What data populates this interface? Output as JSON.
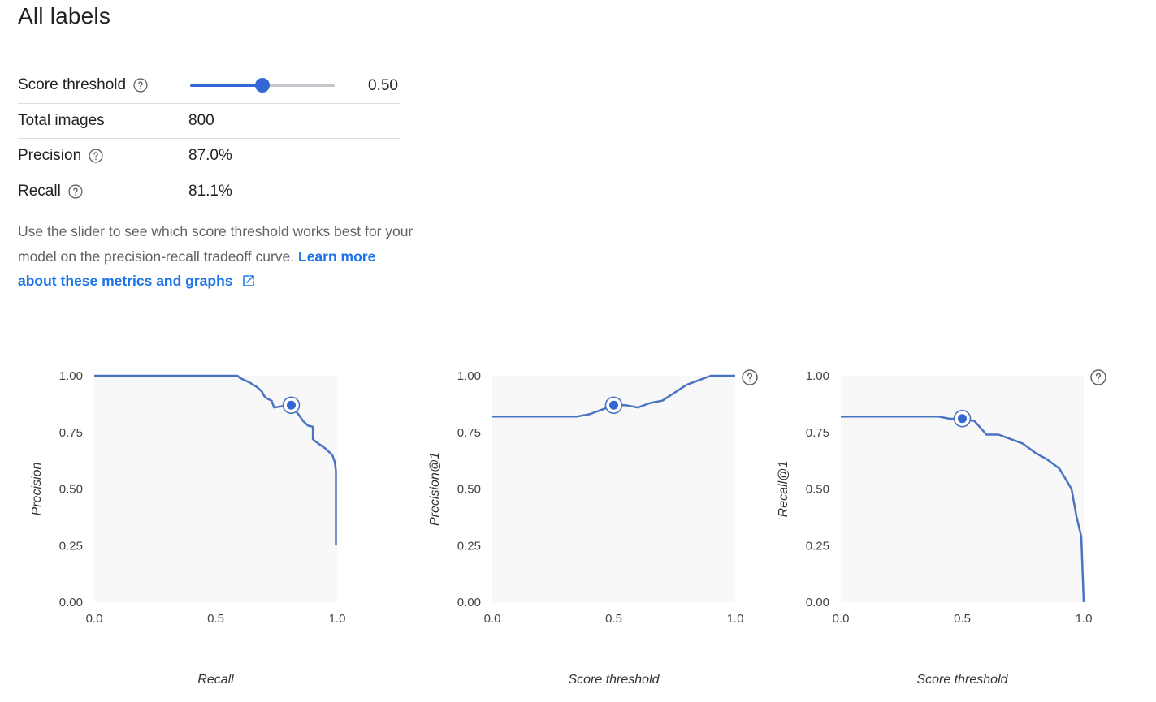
{
  "page": {
    "title": "All labels"
  },
  "metrics": {
    "score_threshold": {
      "label": "Score threshold",
      "value": "0.50",
      "fraction": 0.5
    },
    "total_images": {
      "label": "Total images",
      "value": "800"
    },
    "precision": {
      "label": "Precision",
      "value": "87.0%"
    },
    "recall": {
      "label": "Recall",
      "value": "81.1%"
    }
  },
  "help": {
    "text": "Use the slider to see which score threshold works best for your model on the precision-recall tradeoff curve. ",
    "link_text": "Learn more about these metrics and graphs"
  },
  "colors": {
    "accent": "#3367d6",
    "curve": "#4b74c0",
    "plot_bg": "#f8f8f8",
    "help_icon": "#5f6368"
  },
  "chart_data": [
    {
      "type": "line",
      "title": "",
      "xlabel": "Recall",
      "ylabel": "Precision",
      "xlim": [
        0,
        1
      ],
      "ylim": [
        0,
        1
      ],
      "x_ticks": [
        "0.0",
        "0.5",
        "1.0"
      ],
      "y_ticks": [
        "0.00",
        "0.25",
        "0.50",
        "0.75",
        "1.00"
      ],
      "help_icon": false,
      "series": [
        {
          "x": [
            0.0,
            0.59,
            0.6,
            0.64,
            0.67,
            0.69,
            0.7,
            0.71,
            0.73,
            0.74,
            0.8,
            0.81,
            0.84,
            0.86,
            0.88,
            0.9,
            0.9,
            0.91,
            0.95,
            0.98,
            0.99,
            0.995,
            0.995
          ],
          "y": [
            1.0,
            1.0,
            0.99,
            0.97,
            0.95,
            0.93,
            0.91,
            0.9,
            0.89,
            0.86,
            0.87,
            0.87,
            0.83,
            0.8,
            0.78,
            0.775,
            0.72,
            0.71,
            0.68,
            0.65,
            0.62,
            0.58,
            0.25
          ]
        }
      ],
      "marker": {
        "x": 0.811,
        "y": 0.87
      }
    },
    {
      "type": "line",
      "title": "",
      "xlabel": "Score threshold",
      "ylabel": "Precision@1",
      "xlim": [
        0,
        1
      ],
      "ylim": [
        0,
        1
      ],
      "x_ticks": [
        "0.0",
        "0.5",
        "1.0"
      ],
      "y_ticks": [
        "0.00",
        "0.25",
        "0.50",
        "0.75",
        "1.00"
      ],
      "help_icon": true,
      "series": [
        {
          "x": [
            0.0,
            0.35,
            0.4,
            0.45,
            0.5,
            0.55,
            0.6,
            0.65,
            0.7,
            0.8,
            0.85,
            0.9,
            1.0
          ],
          "y": [
            0.82,
            0.82,
            0.83,
            0.85,
            0.87,
            0.87,
            0.86,
            0.88,
            0.89,
            0.96,
            0.98,
            1.0,
            1.0
          ]
        }
      ],
      "marker": {
        "x": 0.5,
        "y": 0.87
      }
    },
    {
      "type": "line",
      "title": "",
      "xlabel": "Score threshold",
      "ylabel": "Recall@1",
      "xlim": [
        0,
        1
      ],
      "ylim": [
        0,
        1
      ],
      "x_ticks": [
        "0.0",
        "0.5",
        "1.0"
      ],
      "y_ticks": [
        "0.00",
        "0.25",
        "0.50",
        "0.75",
        "1.00"
      ],
      "help_icon": true,
      "series": [
        {
          "x": [
            0.0,
            0.4,
            0.45,
            0.5,
            0.55,
            0.6,
            0.65,
            0.7,
            0.75,
            0.8,
            0.85,
            0.9,
            0.95,
            0.97,
            0.99,
            1.0
          ],
          "y": [
            0.82,
            0.82,
            0.81,
            0.81,
            0.8,
            0.74,
            0.74,
            0.72,
            0.7,
            0.66,
            0.63,
            0.59,
            0.5,
            0.38,
            0.29,
            0.0
          ]
        }
      ],
      "marker": {
        "x": 0.5,
        "y": 0.811
      }
    }
  ]
}
